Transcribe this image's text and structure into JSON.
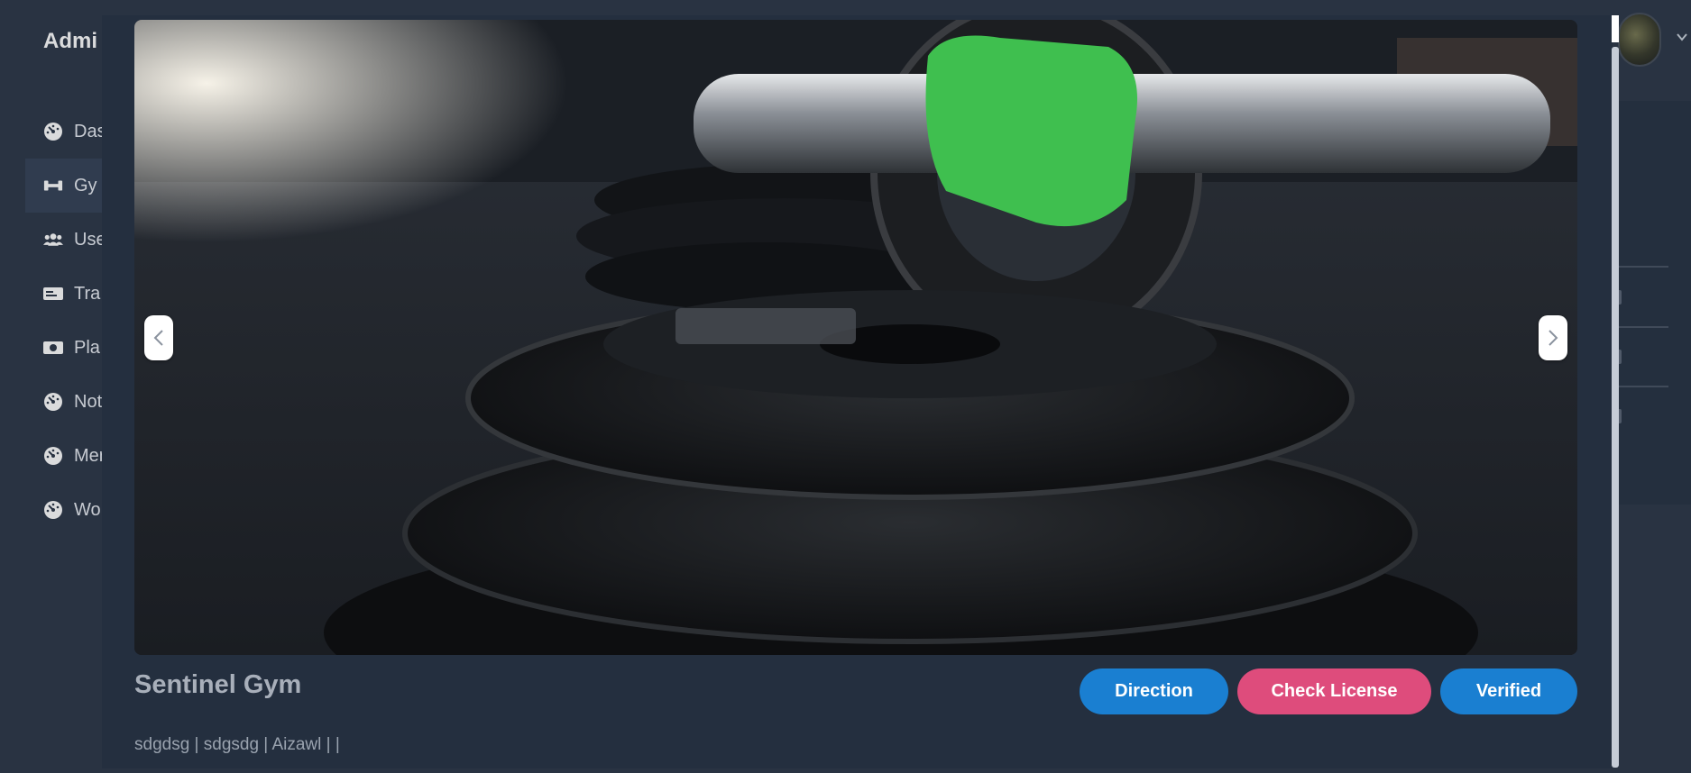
{
  "app": {
    "brand": "Admi"
  },
  "sidebar": {
    "items": [
      {
        "label": "Das",
        "icon": "dashboard-icon",
        "active": false
      },
      {
        "label": "Gy",
        "icon": "dumbbell-icon",
        "active": true
      },
      {
        "label": "Use",
        "icon": "users-icon",
        "active": false
      },
      {
        "label": "Tra",
        "icon": "id-card-icon",
        "active": false
      },
      {
        "label": "Pla",
        "icon": "money-icon",
        "active": false
      },
      {
        "label": "Not",
        "icon": "dashboard-icon",
        "active": false
      },
      {
        "label": "Mer",
        "icon": "dashboard-icon",
        "active": false
      },
      {
        "label": "Wo",
        "icon": "dashboard-icon",
        "active": false
      }
    ]
  },
  "header": {
    "avatar_icon": "avatar",
    "menu_icon": "chevron-down-icon"
  },
  "modal": {
    "image_description_icon": "gym-photo",
    "prev_icon": "chevron-left-icon",
    "next_icon": "chevron-right-icon",
    "gym_name": "Sentinel Gym",
    "address": "sdgdsg | sdgsdg | Aizawl | |",
    "buttons": {
      "direction": "Direction",
      "check_license": "Check License",
      "verified": "Verified"
    }
  },
  "colors": {
    "background": "#2f3a4b",
    "modal_bg": "#242f3f",
    "primary": "#1a7fd1",
    "license": "#de4c7c",
    "title_text": "#a8afba"
  }
}
